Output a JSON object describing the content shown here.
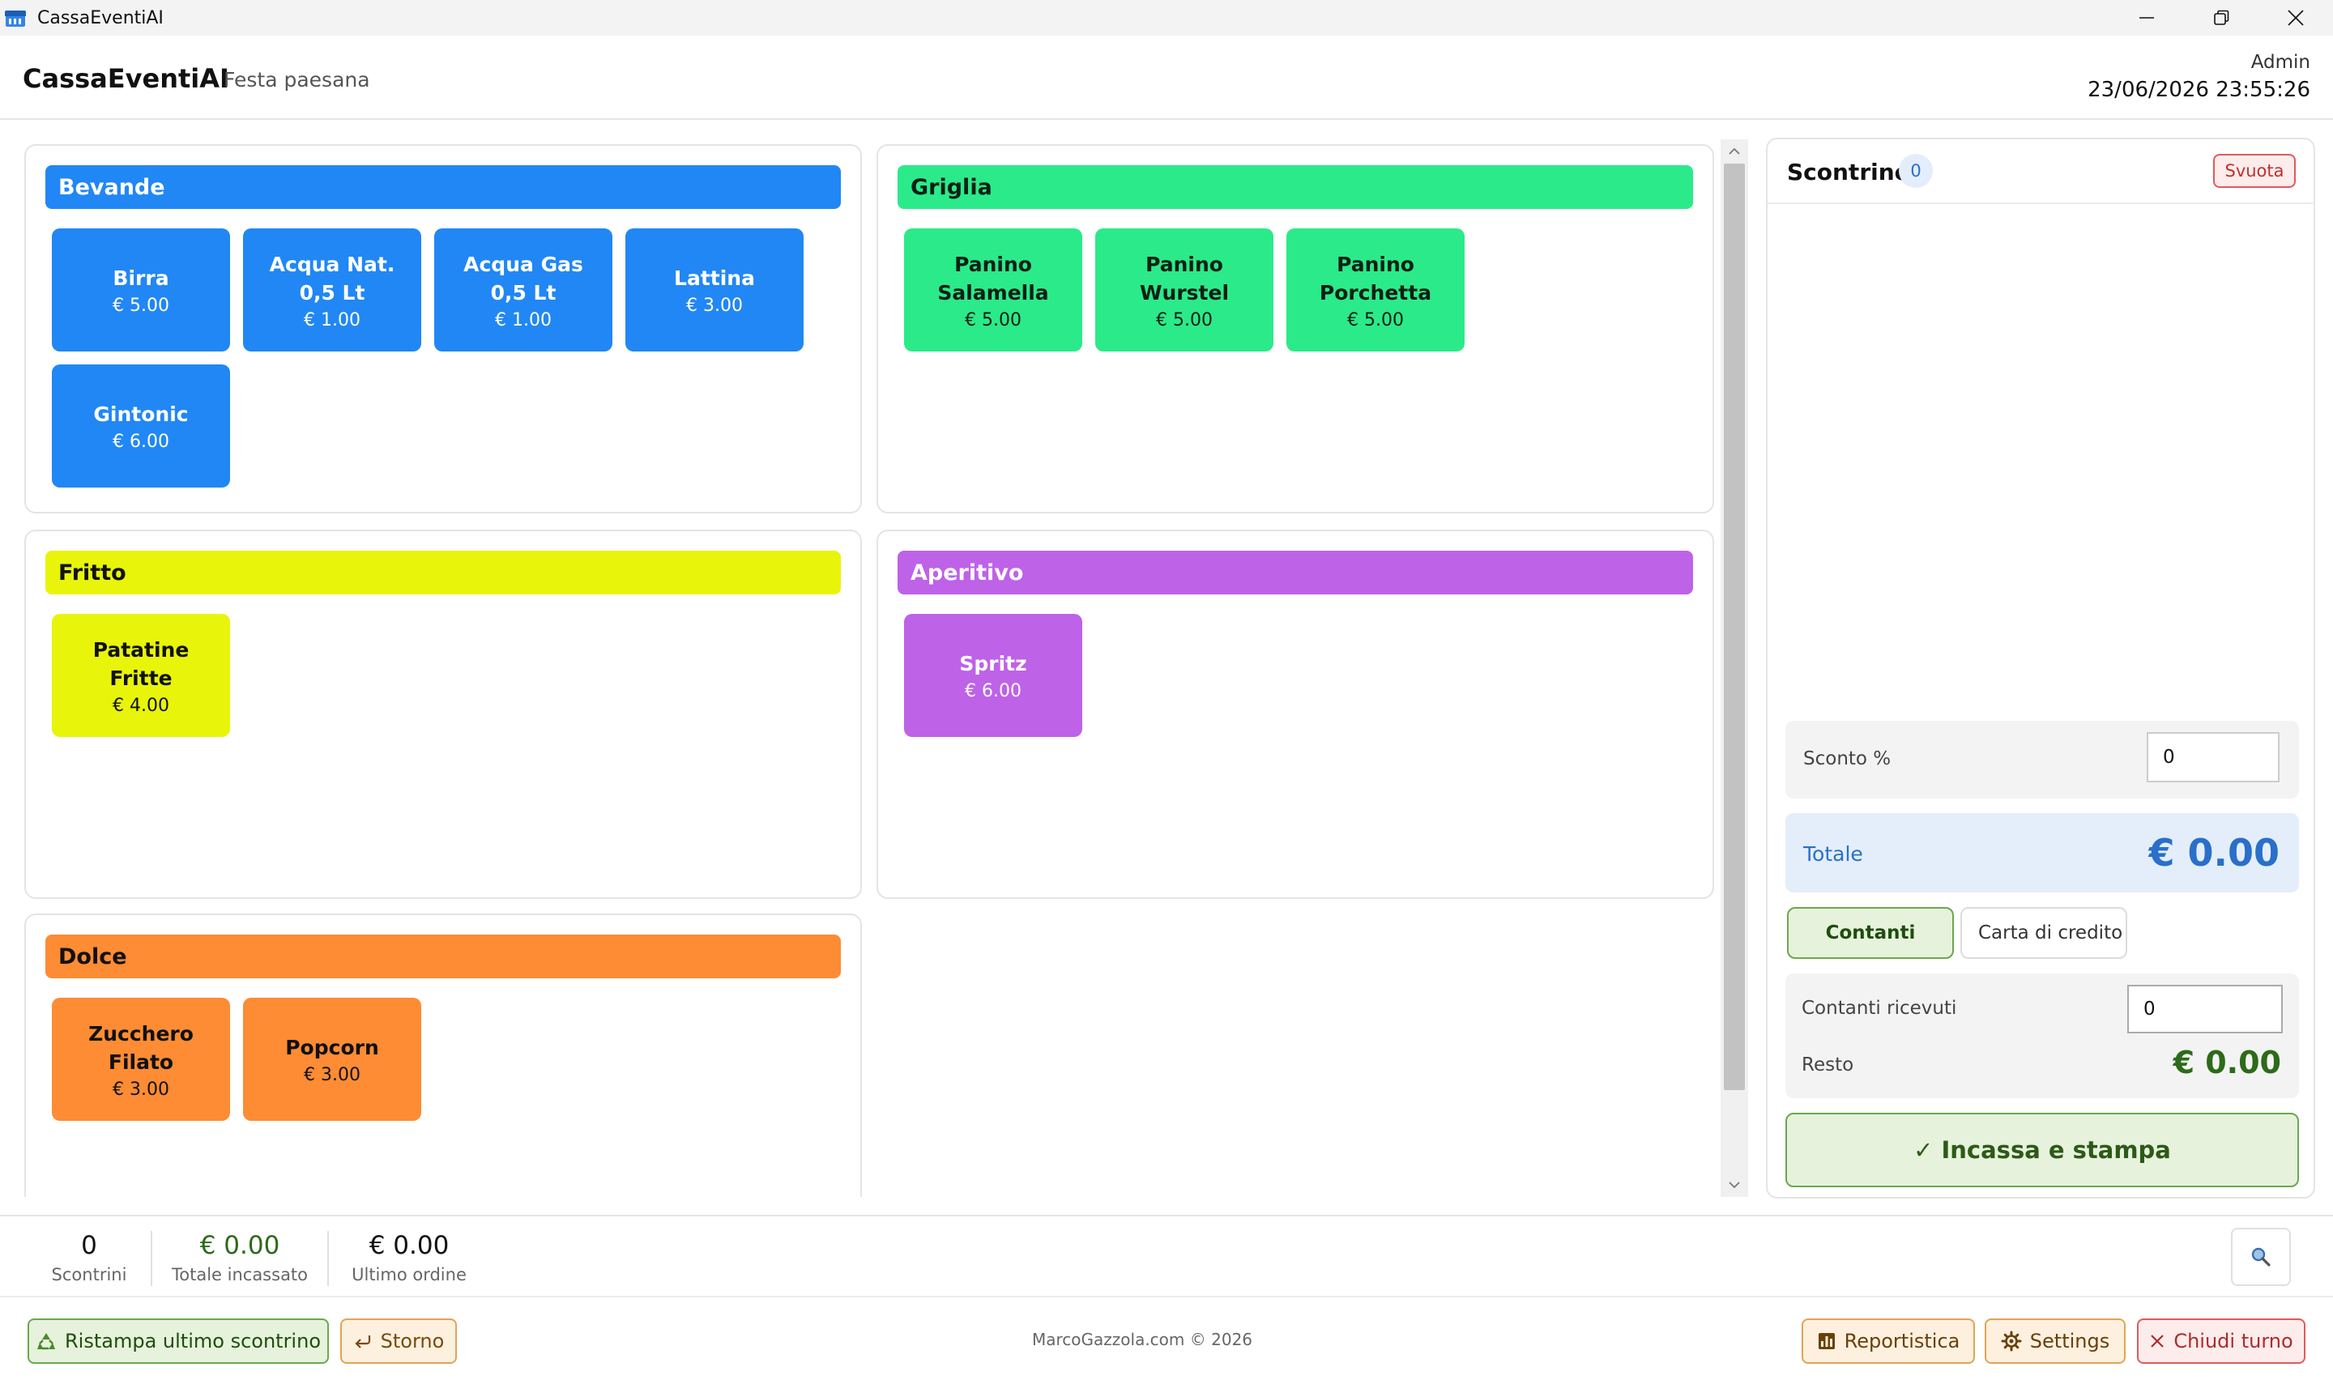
{
  "window": {
    "title": "CassaEventiAI",
    "controls": {
      "minimize": "minimize-icon",
      "restore": "restore-icon",
      "close": "close-icon"
    }
  },
  "header": {
    "brand": "CassaEventiAI",
    "event": "Festa paesana",
    "user": "Admin",
    "datetime": "23/06/2026 23:55:26"
  },
  "categories": [
    {
      "name": "Bevande",
      "color": "#2187f5",
      "text_color": "#ffffff",
      "products": [
        {
          "name": "Birra",
          "price": "€ 5.00"
        },
        {
          "name": "Acqua Nat. 0,5 Lt",
          "price": "€ 1.00"
        },
        {
          "name": "Acqua Gas 0,5 Lt",
          "price": "€ 1.00"
        },
        {
          "name": "Lattina",
          "price": "€ 3.00"
        },
        {
          "name": "Gintonic",
          "price": "€ 6.00"
        }
      ]
    },
    {
      "name": "Griglia",
      "color": "#2bea8a",
      "text_color": "#0d1f14",
      "products": [
        {
          "name": "Panino Salamella",
          "price": "€ 5.00"
        },
        {
          "name": "Panino Wurstel",
          "price": "€ 5.00"
        },
        {
          "name": "Panino Porchetta",
          "price": "€ 5.00"
        }
      ]
    },
    {
      "name": "Fritto",
      "color": "#e8f50a",
      "text_color": "#111111",
      "products": [
        {
          "name": "Patatine Fritte",
          "price": "€ 4.00"
        }
      ]
    },
    {
      "name": "Aperitivo",
      "color": "#be62e8",
      "text_color": "#ffffff",
      "products": [
        {
          "name": "Spritz",
          "price": "€ 6.00"
        }
      ]
    },
    {
      "name": "Dolce",
      "color": "#fd8c34",
      "text_color": "#111111",
      "products": [
        {
          "name": "Zucchero Filato",
          "price": "€ 3.00"
        },
        {
          "name": "Popcorn",
          "price": "€ 3.00"
        }
      ]
    }
  ],
  "receipt": {
    "title": "Scontrino",
    "count": "0",
    "clear_label": "Svuota",
    "discount_label": "Sconto %",
    "discount_value": "0",
    "total_label": "Totale",
    "total_value": "€ 0.00",
    "payment": {
      "cash_label": "Contanti",
      "card_label": "Carta di credito",
      "selected": "Contanti"
    },
    "cash_received_label": "Contanti ricevuti",
    "cash_received_value": "0",
    "change_label": "Resto",
    "change_value": "€ 0.00",
    "checkout_label": "✓ Incassa e stampa"
  },
  "stats": {
    "receipts_value": "0",
    "receipts_label": "Scontrini",
    "total_value": "€ 0.00",
    "total_label": "Totale incassato",
    "last_value": "€ 0.00",
    "last_label": "Ultimo ordine",
    "search_icon": "search-icon"
  },
  "footer": {
    "reprint_label": "Ristampa ultimo scontrino",
    "storno_label": "Storno",
    "copyright": "MarcoGazzola.com © 2026",
    "report_label": "Reportistica",
    "settings_label": "Settings",
    "close_shift_label": "Chiudi turno"
  },
  "colors": {
    "accent_blue": "#2a6fc9",
    "success_green": "#2d6a1a",
    "danger_red": "#c0302f",
    "warning_orange": "#e0a555"
  }
}
